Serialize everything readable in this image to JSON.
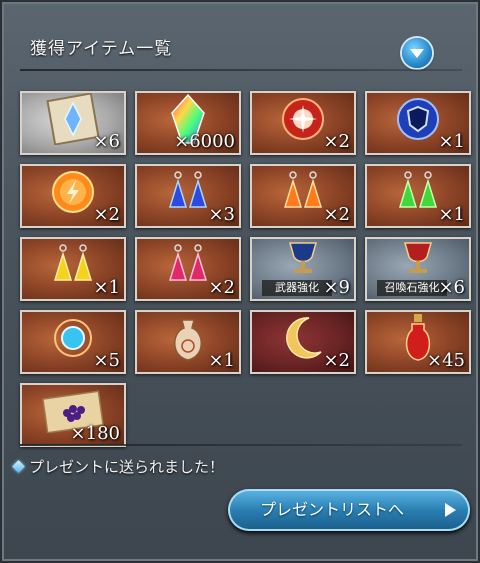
{
  "header": {
    "title": "獲得アイテム一覧"
  },
  "items": [
    {
      "icon": "ticket-crystal-icon",
      "qty": "×6",
      "bg": "silver"
    },
    {
      "icon": "rainbow-crystal-icon",
      "qty": "×6000",
      "bg": "brown"
    },
    {
      "icon": "red-orb-icon",
      "qty": "×2",
      "bg": "brown"
    },
    {
      "icon": "blue-shield-orb-icon",
      "qty": "×1",
      "bg": "brown"
    },
    {
      "icon": "lightning-orb-icon",
      "qty": "×2",
      "bg": "brown"
    },
    {
      "icon": "blue-earrings-icon",
      "qty": "×3",
      "bg": "brown"
    },
    {
      "icon": "orange-earrings-icon",
      "qty": "×2",
      "bg": "brown"
    },
    {
      "icon": "green-earrings-icon",
      "qty": "×1",
      "bg": "brown"
    },
    {
      "icon": "yellow-earrings-icon",
      "qty": "×1",
      "bg": "brown"
    },
    {
      "icon": "pink-earrings-icon",
      "qty": "×2",
      "bg": "brown"
    },
    {
      "icon": "weapon-chalice-icon",
      "qty": "×9",
      "bg": "steel",
      "banner": "武器強化"
    },
    {
      "icon": "summon-chalice-icon",
      "qty": "×6",
      "bg": "steel",
      "banner": "召喚石強化"
    },
    {
      "icon": "blue-gem-icon",
      "qty": "×5",
      "bg": "brown"
    },
    {
      "icon": "pouch-icon",
      "qty": "×1",
      "bg": "brown"
    },
    {
      "icon": "crescent-moon-icon",
      "qty": "×2",
      "bg": "wine"
    },
    {
      "icon": "red-potion-icon",
      "qty": "×45",
      "bg": "brown"
    },
    {
      "icon": "purple-berries-icon",
      "qty": "×180",
      "bg": "brown"
    }
  ],
  "message": "プレゼントに送られました！",
  "button": {
    "label": "プレゼントリストへ"
  }
}
